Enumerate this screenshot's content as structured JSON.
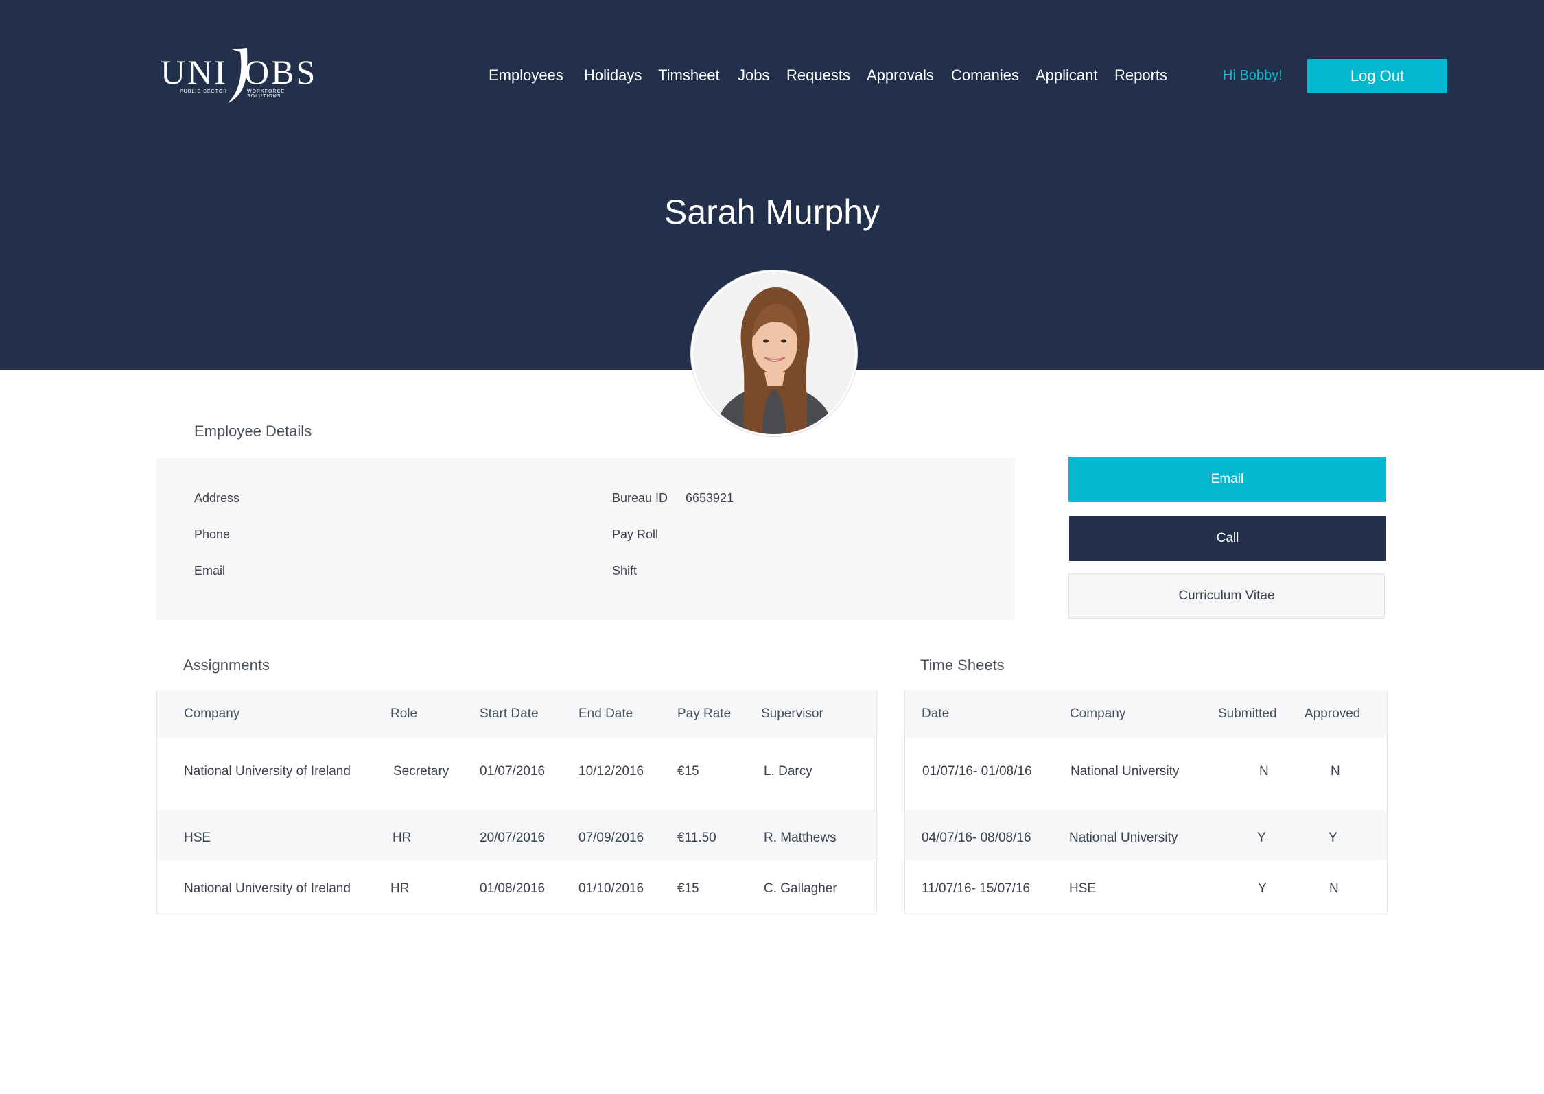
{
  "brand": {
    "logo_text_left": "UNI",
    "logo_text_right": "OBS",
    "tagline_left": "PUBLIC SECTOR",
    "tagline_right": "WORKFORCE SOLUTIONS"
  },
  "nav": {
    "items": [
      "Employees",
      "Holidays",
      "Timsheet",
      "Jobs",
      "Requests",
      "Approvals",
      "Comanies",
      "Applicant",
      "Reports"
    ]
  },
  "user": {
    "greeting": "Hi Bobby!",
    "logout_label": "Log Out"
  },
  "profile": {
    "name": "Sarah Murphy",
    "avatar_icon": "person-photo"
  },
  "employee_details": {
    "title": "Employee Details",
    "address_label": "Address",
    "phone_label": "Phone",
    "email_label": "Email",
    "bureau_id_label": "Bureau ID",
    "bureau_id_value": "6653921",
    "payroll_label": "Pay Roll",
    "shift_label": "Shift"
  },
  "actions": {
    "email": "Email",
    "call": "Call",
    "cv": "Curriculum Vitae"
  },
  "assignments": {
    "title": "Assignments",
    "columns": [
      "Company",
      "Role",
      "Start Date",
      "End Date",
      "Pay Rate",
      "Supervisor"
    ],
    "rows": [
      [
        "National University of Ireland",
        "Secretary",
        "01/07/2016",
        "10/12/2016",
        "€15",
        "L. Darcy"
      ],
      [
        "HSE",
        "HR",
        "20/07/2016",
        "07/09/2016",
        "€11.50",
        "R. Matthews"
      ],
      [
        "National University of Ireland",
        "HR",
        "01/08/2016",
        "01/10/2016",
        "€15",
        "C. Gallagher"
      ]
    ]
  },
  "timesheets": {
    "title": "Time Sheets",
    "columns": [
      "Date",
      "Company",
      "Submitted",
      "Approved"
    ],
    "rows": [
      [
        "01/07/16- 01/08/16",
        "National University",
        "N",
        "N"
      ],
      [
        "04/07/16- 08/08/16",
        "National University",
        "Y",
        "Y"
      ],
      [
        "11/07/16- 15/07/16",
        "HSE",
        "Y",
        "N"
      ]
    ]
  },
  "colors": {
    "navy": "#22304c",
    "accent": "#06b8cf"
  }
}
